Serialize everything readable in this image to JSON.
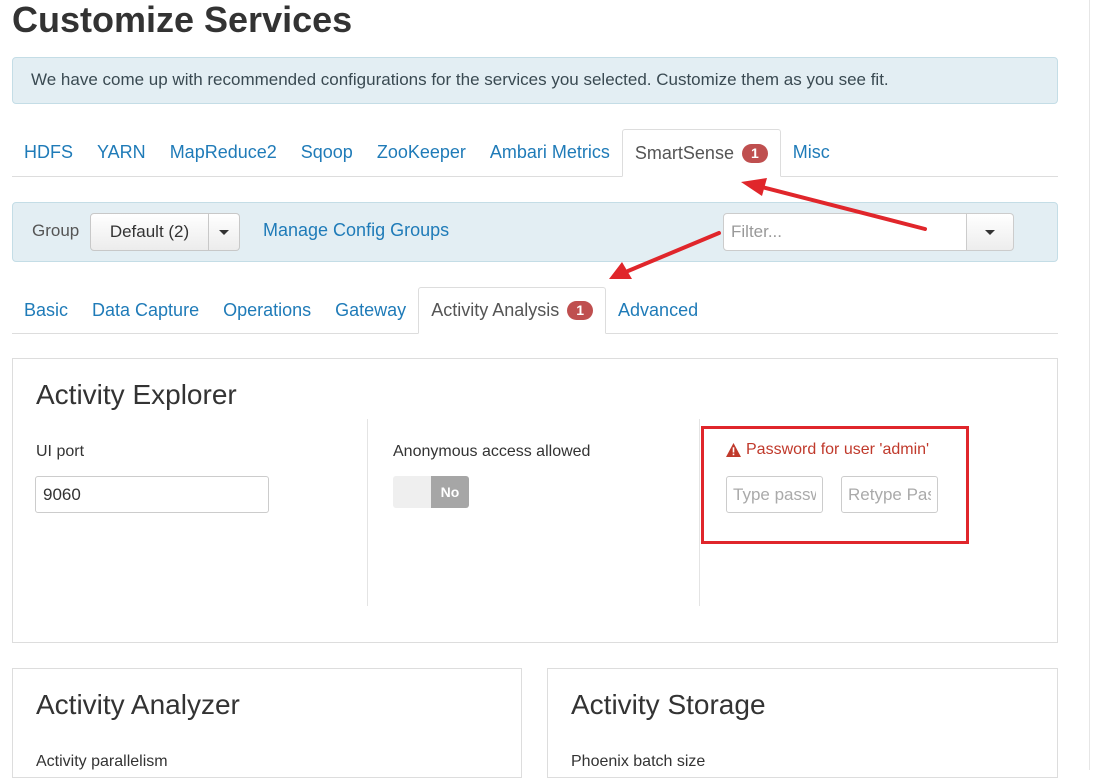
{
  "page": {
    "title": "Customize Services"
  },
  "alert": {
    "text": "We have come up with recommended configurations for the services you selected. Customize them as you see fit."
  },
  "service_tabs": [
    {
      "label": "HDFS"
    },
    {
      "label": "YARN"
    },
    {
      "label": "MapReduce2"
    },
    {
      "label": "Sqoop"
    },
    {
      "label": "ZooKeeper"
    },
    {
      "label": "Ambari Metrics"
    },
    {
      "label": "SmartSense",
      "badge": "1",
      "active": true
    },
    {
      "label": "Misc"
    }
  ],
  "group_bar": {
    "label": "Group",
    "selected": "Default (2)",
    "manage_link": "Manage Config Groups",
    "filter_placeholder": "Filter..."
  },
  "sub_tabs": [
    {
      "label": "Basic"
    },
    {
      "label": "Data Capture"
    },
    {
      "label": "Operations"
    },
    {
      "label": "Gateway"
    },
    {
      "label": "Activity Analysis",
      "badge": "1",
      "active": true
    },
    {
      "label": "Advanced"
    }
  ],
  "activity_explorer": {
    "title": "Activity Explorer",
    "ui_port": {
      "label": "UI port",
      "value": "9060"
    },
    "anonymous": {
      "label": "Anonymous access allowed",
      "toggle_text": "No"
    },
    "password": {
      "label": "Password for user 'admin'",
      "placeholder": "Type password",
      "retype_placeholder": "Retype Password"
    }
  },
  "activity_analyzer": {
    "title": "Activity Analyzer",
    "field_label": "Activity parallelism"
  },
  "activity_storage": {
    "title": "Activity Storage",
    "field_label": "Phoenix batch size"
  },
  "colors": {
    "link": "#1f7bb8",
    "badge": "#bf4f4f",
    "warning": "#c0392b",
    "annotation": "#e0262b",
    "panel_bg": "#e3eef3"
  }
}
